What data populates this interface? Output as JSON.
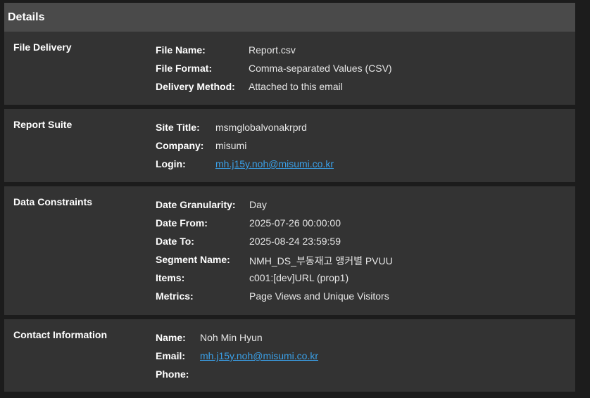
{
  "header": {
    "title": "Details"
  },
  "file_delivery": {
    "label": "File Delivery",
    "rows": [
      {
        "key": "File Name:",
        "value": "Report.csv"
      },
      {
        "key": "File Format:",
        "value": "Comma-separated Values (CSV)"
      },
      {
        "key": "Delivery Method:",
        "value": "Attached to this email"
      }
    ]
  },
  "report_suite": {
    "label": "Report Suite",
    "rows": [
      {
        "key": "Site Title:",
        "value": "msmglobalvonakrprd"
      },
      {
        "key": "Company:",
        "value": "misumi"
      },
      {
        "key": "Login:",
        "value": "mh.j15y.noh@misumi.co.kr"
      }
    ]
  },
  "data_constraints": {
    "label": "Data Constraints",
    "rows": [
      {
        "key": "Date Granularity:",
        "value": "Day"
      },
      {
        "key": "Date From:",
        "value": "2025-07-26 00:00:00"
      },
      {
        "key": "Date To:",
        "value": "2025-08-24 23:59:59"
      },
      {
        "key": "Segment Name:",
        "value": "NMH_DS_부동재고 앵커별 PVUU"
      },
      {
        "key": "Items:",
        "value": "c001:[dev]URL (prop1)"
      },
      {
        "key": "Metrics:",
        "value": "Page Views and Unique Visitors"
      }
    ]
  },
  "contact_information": {
    "label": "Contact Information",
    "rows": [
      {
        "key": "Name:",
        "value": "Noh Min Hyun"
      },
      {
        "key": "Email:",
        "value": "mh.j15y.noh@misumi.co.kr"
      },
      {
        "key": "Phone:",
        "value": ""
      }
    ]
  },
  "colors": {
    "header_bg": "#4a4a4a",
    "section_bg": "#333333",
    "page_bg": "#1c1c1c",
    "link": "#3aa0e8"
  }
}
